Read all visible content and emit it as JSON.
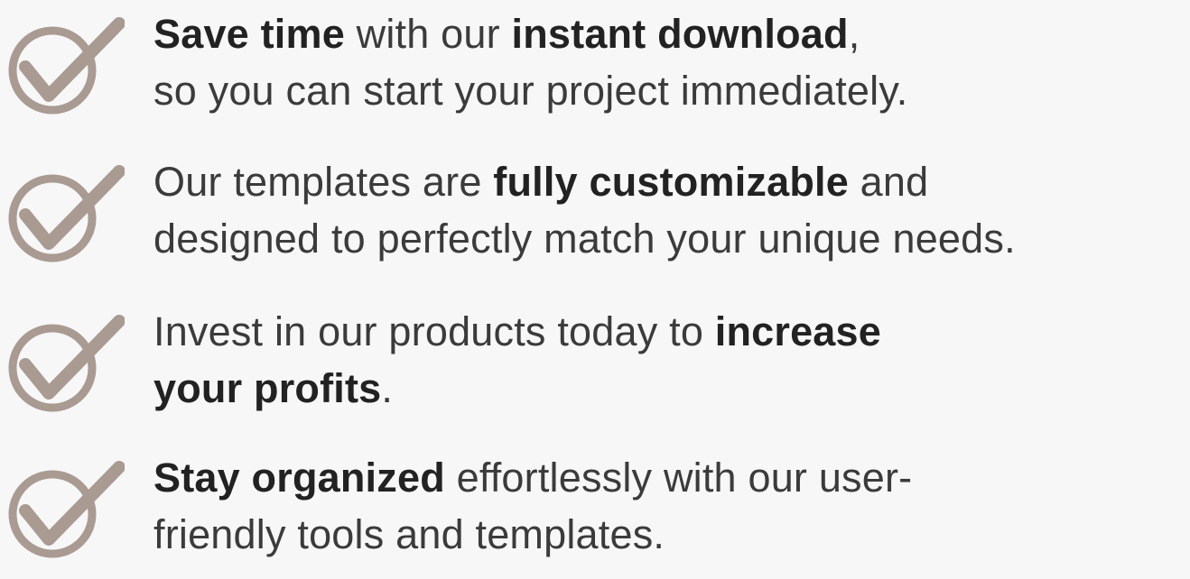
{
  "colors": {
    "background": "#f7f7f7",
    "text": "#3b3b3b",
    "bold_text": "#222222",
    "check_icon": "#a99b92"
  },
  "icon": "checkmark-circle-icon",
  "features": [
    {
      "line1": {
        "b1": "Save time",
        "t1": " with our ",
        "b2": "instant download",
        "t2": ","
      },
      "line2": "so you can start your project immediately."
    },
    {
      "line1": {
        "t1": "Our templates are ",
        "b1": "fully customizable",
        "t2": " and"
      },
      "line2": "designed to perfectly match your unique needs."
    },
    {
      "line1": {
        "t1": "Invest in our products today to ",
        "b1": "increase"
      },
      "line2": {
        "b1": "your profits",
        "t1": "."
      }
    },
    {
      "line1": {
        "b1": "Stay organized",
        "t1": " effortlessly with our user-"
      },
      "line2": "friendly tools and templates."
    }
  ]
}
